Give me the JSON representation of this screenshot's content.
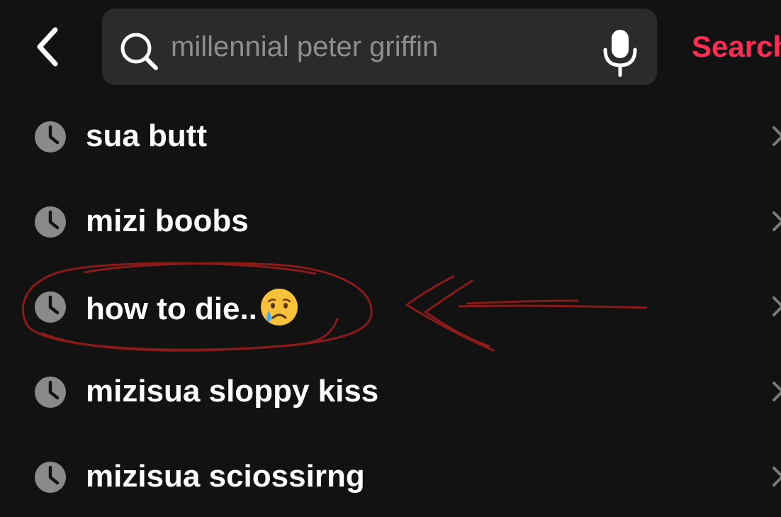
{
  "header": {
    "back_icon": "chevron-left-icon",
    "search": {
      "value": "",
      "placeholder": "millennial peter griffin",
      "search_icon": "magnifier-icon",
      "voice_icon": "microphone-icon"
    },
    "action_label": "Search"
  },
  "history": {
    "items": [
      {
        "label": "sua butt",
        "icon": "clock-icon",
        "remove_icon": "close-icon"
      },
      {
        "label": "mizi boobs",
        "icon": "clock-icon",
        "remove_icon": "close-icon"
      },
      {
        "label": "how to die..",
        "emoji": "crying-face",
        "icon": "clock-icon",
        "remove_icon": "close-icon"
      },
      {
        "label": "mizisua sloppy kiss",
        "icon": "clock-icon",
        "remove_icon": "close-icon"
      },
      {
        "label": "mizisua sciossirng",
        "icon": "clock-icon",
        "remove_icon": "close-icon"
      }
    ]
  },
  "annotation": {
    "color": "#8b1a1a",
    "highlighted_item": "how to die.."
  },
  "colors": {
    "background": "#121212",
    "search_field": "#2b2b2b",
    "accent": "#fe2c55",
    "placeholder": "#8e8e8e",
    "icon_gray": "#8a8a8a",
    "text": "#ffffff"
  }
}
